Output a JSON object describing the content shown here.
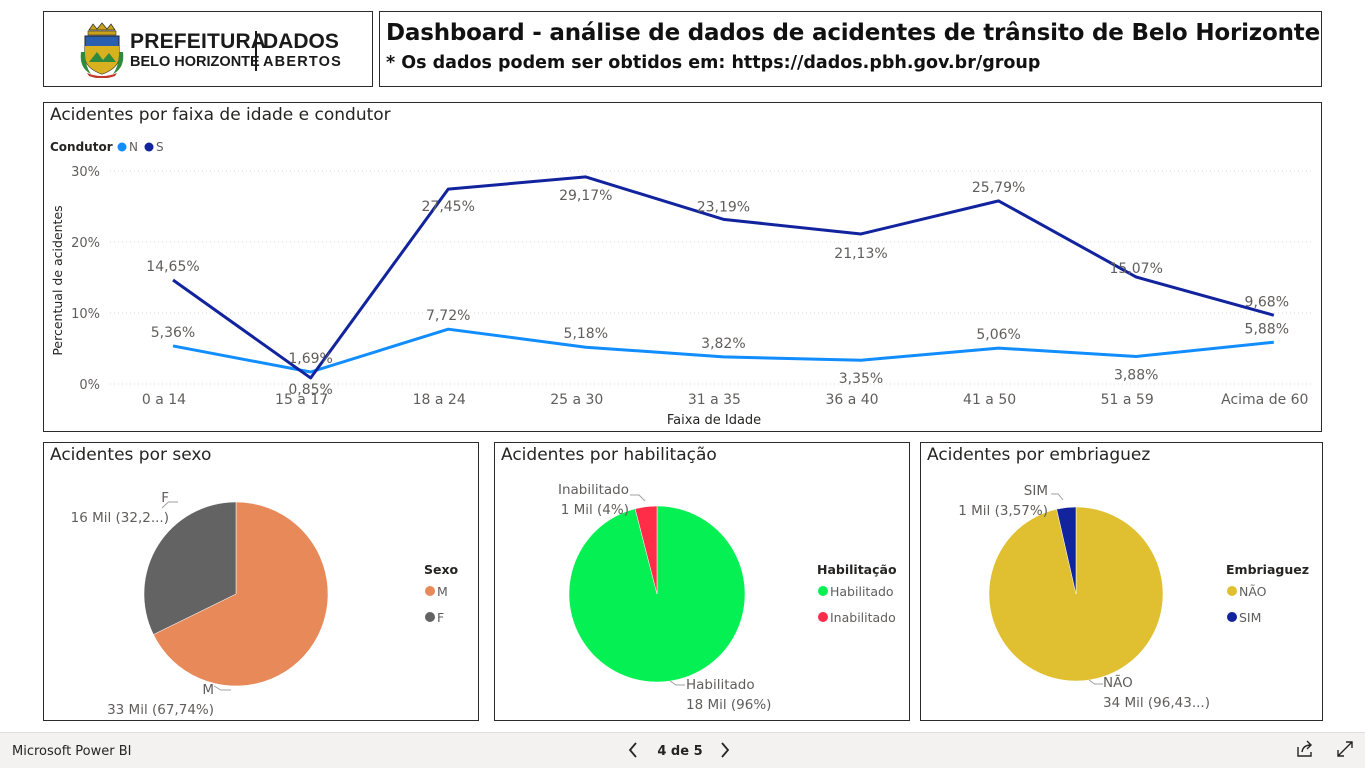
{
  "header": {
    "logo": {
      "line1": "PREFEITURA",
      "line2": "BELO HORIZONTE",
      "line3": "DADOS",
      "line4": "ABERTOS"
    },
    "title": "Dashboard - análise de dados de acidentes de trânsito de Belo Horizonte",
    "subtitle": "* Os dados podem ser obtidos em: https://dados.pbh.gov.br/group"
  },
  "chart_data": [
    {
      "type": "line",
      "title": "Acidentes por faixa de idade e condutor",
      "legend_title": "Condutor",
      "legend_position": "top-left",
      "xlabel": "Faixa de Idade",
      "ylabel": "Percentual de acidentes",
      "ylim": [
        0,
        30
      ],
      "yticks": [
        "0%",
        "10%",
        "20%",
        "30%"
      ],
      "grid": true,
      "categories": [
        "0 a 14",
        "15 a 17",
        "18 a 24",
        "25 a 30",
        "31 a 35",
        "36 a 40",
        "41 a 50",
        "51 a 59",
        "Acima de 60"
      ],
      "series": [
        {
          "name": "N",
          "color": "#118DFF",
          "values": [
            5.36,
            1.69,
            7.72,
            5.18,
            3.82,
            3.35,
            5.06,
            3.88,
            5.88
          ],
          "labels": [
            "5,36%",
            "1,69%",
            "7,72%",
            "5,18%",
            "3,82%",
            "3,35%",
            "5,06%",
            "3,88%",
            "5,88%"
          ]
        },
        {
          "name": "S",
          "color": "#12239E",
          "values": [
            14.65,
            0.85,
            27.45,
            29.17,
            23.19,
            21.13,
            25.79,
            15.07,
            9.68
          ],
          "labels": [
            "14,65%",
            "0,85%",
            "27,45%",
            "29,17%",
            "23,19%",
            "21,13%",
            "25,79%",
            "15,07%",
            "9,68%"
          ]
        }
      ]
    },
    {
      "type": "pie",
      "title": "Acidentes por sexo",
      "legend_title": "Sexo",
      "legend_position": "right",
      "slices": [
        {
          "name": "M",
          "value": 67.74,
          "label": "33 Mil (67,74%)",
          "color": "#E8895A"
        },
        {
          "name": "F",
          "value": 32.26,
          "label": "16 Mil (32,2...)",
          "color": "#636363"
        }
      ]
    },
    {
      "type": "pie",
      "title": "Acidentes por habilitação",
      "legend_title": "Habilitação",
      "legend_position": "right",
      "slices": [
        {
          "name": "Habilitado",
          "value": 96,
          "label": "18 Mil (96%)",
          "color": "#05F052"
        },
        {
          "name": "Inabilitado",
          "value": 4,
          "label": "1 Mil (4%)",
          "color": "#FF2D48"
        }
      ]
    },
    {
      "type": "pie",
      "title": "Acidentes por embriaguez",
      "legend_title": "Embriaguez",
      "legend_position": "right",
      "slices": [
        {
          "name": "NÃO",
          "value": 96.43,
          "label": "34 Mil (96,43...)",
          "color": "#E0C030"
        },
        {
          "name": "SIM",
          "value": 3.57,
          "label": "1 Mil (3,57%)",
          "color": "#12239E"
        }
      ]
    }
  ],
  "footer": {
    "brand": "Microsoft Power BI",
    "page": "4 de 5",
    "prev_icon": "chevron-left-icon",
    "next_icon": "chevron-right-icon",
    "share_icon": "share-icon",
    "fullscreen_icon": "fullscreen-icon"
  }
}
